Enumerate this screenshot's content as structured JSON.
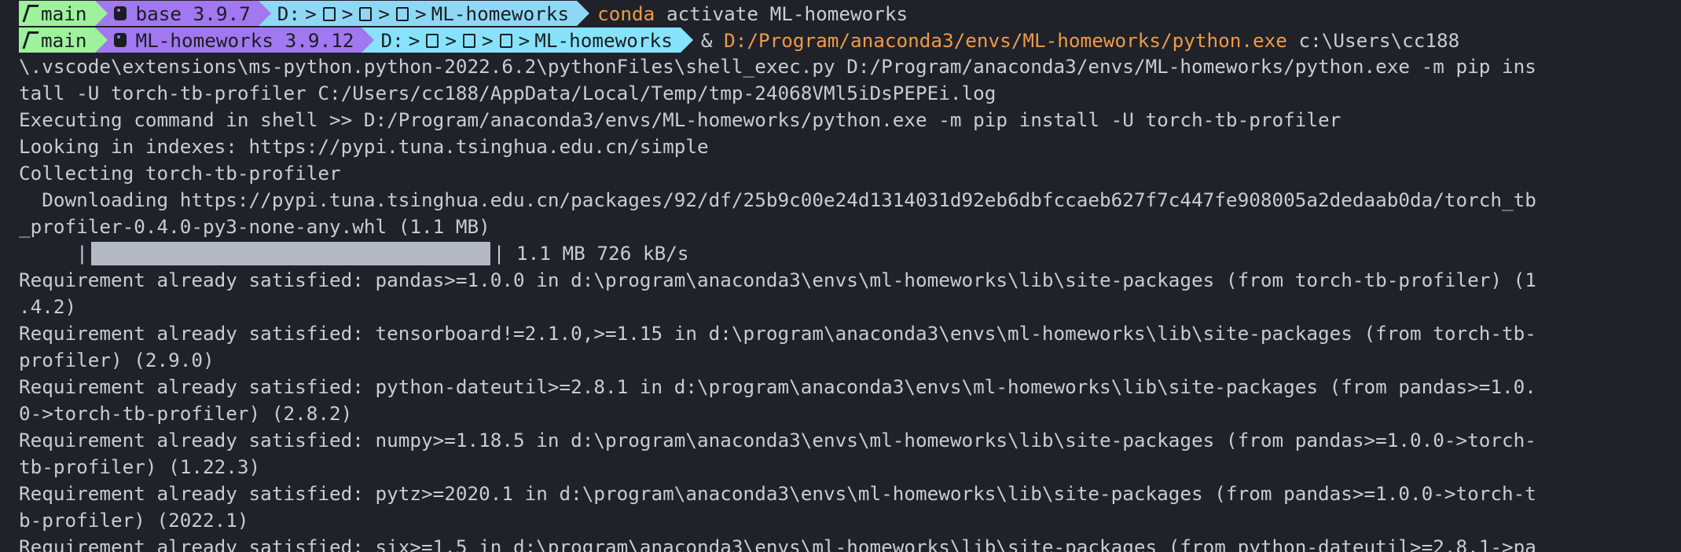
{
  "prompt1": {
    "branch": "main",
    "env": "base 3.9.7",
    "drive": "D:",
    "folder": "ML-homeworks",
    "cmd_word": "conda",
    "cmd_rest": " activate ML-homeworks"
  },
  "prompt2": {
    "branch": "main",
    "env": "ML-homeworks 3.9.12",
    "drive": "D:",
    "folder": "ML-homeworks",
    "amp": "& ",
    "exe": "D:/Program/anaconda3/envs/ML-homeworks/python.exe",
    "arg_start": " c:\\Users\\cc188"
  },
  "icons": {
    "branch": "git-branch-icon",
    "python": "python-icon",
    "folder": "folder-icon",
    "separator": ">"
  },
  "colors": {
    "background": "#1f2229",
    "text": "#c9ccd3",
    "git_segment": "#9df29b",
    "env_segment": "#a178f0",
    "path_segment": "#8fd8f5",
    "highlight": "#ef9a4a",
    "progress_bar": "#b5b9c2"
  },
  "lines": [
    "\\.vscode\\extensions\\ms-python.python-2022.6.2\\pythonFiles\\shell_exec.py D:/Program/anaconda3/envs/ML-homeworks/python.exe -m pip ins",
    "tall -U torch-tb-profiler C:/Users/cc188/AppData/Local/Temp/tmp-24068VMl5iDsPEPEi.log",
    "Executing command in shell >> D:/Program/anaconda3/envs/ML-homeworks/python.exe -m pip install -U torch-tb-profiler",
    "Looking in indexes: https://pypi.tuna.tsinghua.edu.cn/simple",
    "Collecting torch-tb-profiler",
    "  Downloading https://pypi.tuna.tsinghua.edu.cn/packages/92/df/25b9c00e24d1314031d92eb6dbfccaeb627f7c447fe908005a2dedaab0da/torch_tb",
    "_profiler-0.4.0-py3-none-any.whl (1.1 MB)"
  ],
  "progress": {
    "prefix": "     |",
    "suffix": "| 1.1 MB 726 kB/s",
    "fraction": 1.0
  },
  "lines_after": [
    "Requirement already satisfied: pandas>=1.0.0 in d:\\program\\anaconda3\\envs\\ml-homeworks\\lib\\site-packages (from torch-tb-profiler) (1",
    ".4.2)",
    "Requirement already satisfied: tensorboard!=2.1.0,>=1.15 in d:\\program\\anaconda3\\envs\\ml-homeworks\\lib\\site-packages (from torch-tb-",
    "profiler) (2.9.0)",
    "Requirement already satisfied: python-dateutil>=2.8.1 in d:\\program\\anaconda3\\envs\\ml-homeworks\\lib\\site-packages (from pandas>=1.0.",
    "0->torch-tb-profiler) (2.8.2)",
    "Requirement already satisfied: numpy>=1.18.5 in d:\\program\\anaconda3\\envs\\ml-homeworks\\lib\\site-packages (from pandas>=1.0.0->torch-",
    "tb-profiler) (1.22.3)",
    "Requirement already satisfied: pytz>=2020.1 in d:\\program\\anaconda3\\envs\\ml-homeworks\\lib\\site-packages (from pandas>=1.0.0->torch-t",
    "b-profiler) (2022.1)",
    "Requirement already satisfied: six>=1.5 in d:\\program\\anaconda3\\envs\\ml-homeworks\\lib\\site-packages (from python-dateutil>=2.8.1->pa"
  ]
}
